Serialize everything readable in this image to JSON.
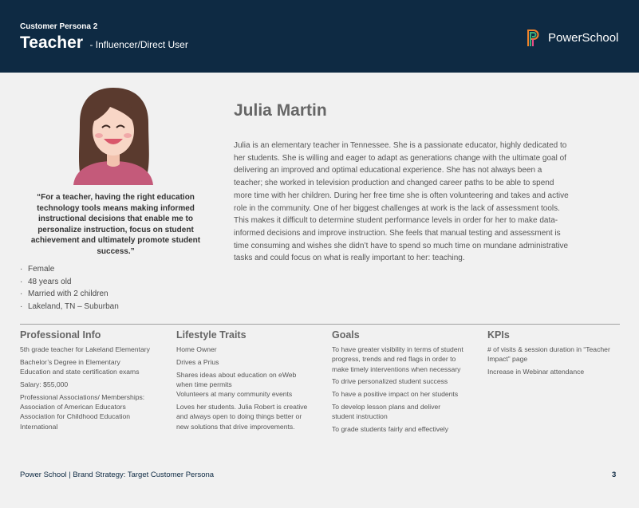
{
  "header": {
    "eyebrow": "Customer Persona 2",
    "title": "Teacher",
    "subtitle": "- Influencer/Direct User",
    "logo_text": "PowerSchool"
  },
  "persona": {
    "name": "Julia Martin",
    "quote": "“For a teacher, having the right education technology tools means making informed instructional decisions that enable me to personalize instruction, focus on student achievement and ultimately promote student success.”",
    "facts": [
      "Female",
      "48 years old",
      "Married with 2 children",
      "Lakeland, TN – Suburban"
    ],
    "bio": "Julia is an elementary teacher in Tennessee. She is a passionate educator, highly dedicated to her students. She is willing and eager to adapt as generations change with the ultimate goal of delivering an improved and optimal educational experience. She has not always been a teacher; she worked in television production and changed career paths to be able to spend more time with her children. During her free time she is often volunteering and takes and active role in the community. One of her biggest challenges at work is the lack of assessment tools. This makes it difficult to determine student performance levels in order for her to make data-informed decisions and improve instruction. She feels that manual testing and assessment is time consuming and wishes she didn’t have to spend so much time on mundane administrative tasks and could focus on what is really important to her: teaching."
  },
  "columns": {
    "professional": {
      "heading": "Professional Info",
      "items": [
        "5th grade teacher for Lakeland Elementary",
        "Bachelor’s Degree in Elementary Education and state certification exams",
        "Salary: $55,000",
        "Professional Associations/ Memberships: Association of American Educators Association for Childhood Education International"
      ]
    },
    "lifestyle": {
      "heading": "Lifestyle Traits",
      "items": [
        "Home Owner",
        "Drives a Prius",
        "Shares ideas about education on eWeb when time permits",
        "Volunteers at many community events",
        "Loves her students. Julia Robert is creative and always open to doing things better or new solutions that drive improvements."
      ]
    },
    "goals": {
      "heading": "Goals",
      "items": [
        "To have greater visibility in terms of student progress, trends and red flags in order to make timely interventions when necessary",
        "To drive personalized student success",
        "To have a positive impact on her students",
        "To develop lesson plans and deliver student instruction",
        "To grade students fairly and effectively"
      ]
    },
    "kpis": {
      "heading": "KPIs",
      "items": [
        "# of visits & session duration in “Teacher Impact” page",
        "Increase in Webinar attendance"
      ]
    }
  },
  "footer": {
    "left": "Power School | Brand Strategy: Target Customer Persona",
    "page": "3"
  },
  "colors": {
    "header_bg": "#0e2a43",
    "page_bg": "#f1f1f1",
    "logo_orange": "#f0822a",
    "logo_green": "#3bb07a",
    "logo_pink": "#e74b86"
  }
}
